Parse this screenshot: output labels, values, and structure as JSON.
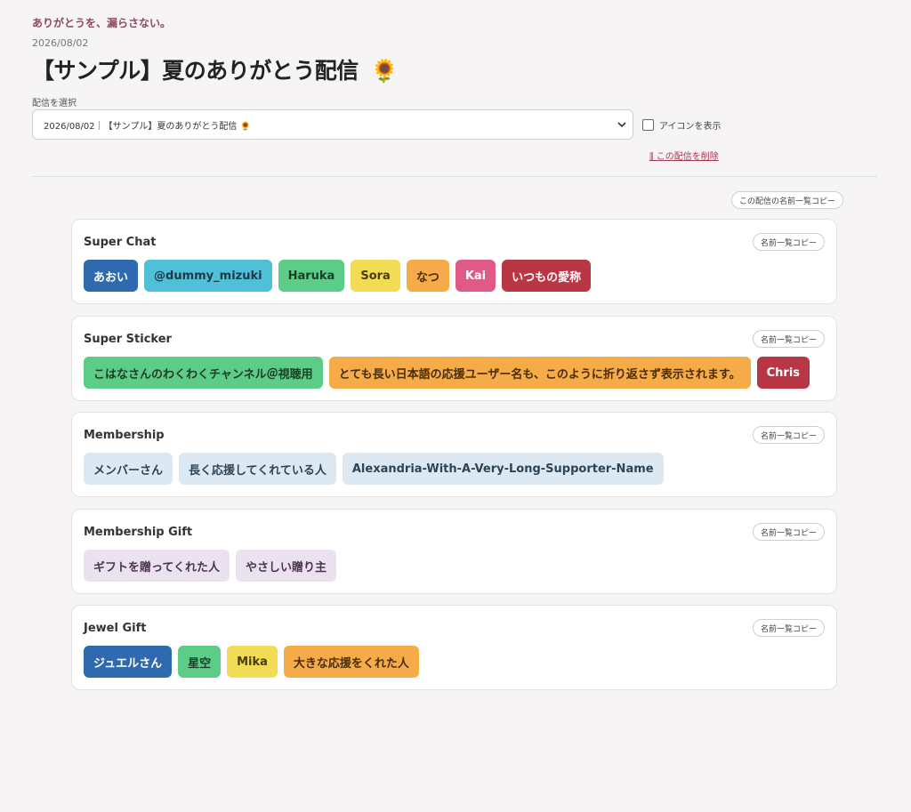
{
  "tagline": "ありがとうを、漏らさない。",
  "date": "2026/08/02",
  "title": "【サンプル】夏のありがとう配信",
  "title_emoji": "🌻",
  "select": {
    "label": "配信を選択",
    "value": "2026/08/02｜【サンプル】夏のありがとう配信 🌻"
  },
  "show_icons_label": "アイコンを表示",
  "delete_label": "この配信を削除",
  "copy_all_label": "この配信の名前一覧コピー",
  "colors": {
    "blue": "#2e6aad",
    "cyan": "#4fc0d8",
    "green": "#5ccc86",
    "yellow": "#f2dc55",
    "orange": "#f5ab48",
    "pink": "#df5a88",
    "red": "#b93744",
    "lightblue": "#dde9f2",
    "lavender": "#ebe2ef"
  },
  "sections": [
    {
      "title": "Super Chat",
      "copy_label": "名前一覧コピー",
      "names": [
        {
          "name": "あおい",
          "color": "blue"
        },
        {
          "name": "@dummy_mizuki",
          "color": "cyan"
        },
        {
          "name": "Haruka",
          "color": "green"
        },
        {
          "name": "Sora",
          "color": "yellow"
        },
        {
          "name": "なつ",
          "color": "orange"
        },
        {
          "name": "Kai",
          "color": "pink"
        },
        {
          "name": "いつもの愛称",
          "color": "red"
        }
      ]
    },
    {
      "title": "Super Sticker",
      "copy_label": "名前一覧コピー",
      "names": [
        {
          "name": "こはなさんのわくわくチャンネル＠視聴用",
          "color": "green"
        },
        {
          "name": "とても長い日本語の応援ユーザー名も、このように折り返さず表示されます。",
          "color": "orange"
        },
        {
          "name": "Chris",
          "color": "red"
        }
      ]
    },
    {
      "title": "Membership",
      "copy_label": "名前一覧コピー",
      "names": [
        {
          "name": "メンバーさん",
          "color": "lightblue"
        },
        {
          "name": "長く応援してくれている人",
          "color": "lightblue"
        },
        {
          "name": "Alexandria-With-A-Very-Long-Supporter-Name",
          "color": "lightblue"
        }
      ]
    },
    {
      "title": "Membership Gift",
      "copy_label": "名前一覧コピー",
      "names": [
        {
          "name": "ギフトを贈ってくれた人",
          "color": "lavender"
        },
        {
          "name": "やさしい贈り主",
          "color": "lavender"
        }
      ]
    },
    {
      "title": "Jewel Gift",
      "copy_label": "名前一覧コピー",
      "names": [
        {
          "name": "ジュエルさん",
          "color": "blue"
        },
        {
          "name": "星空",
          "color": "green"
        },
        {
          "name": "Mika",
          "color": "yellow"
        },
        {
          "name": "大きな応援をくれた人",
          "color": "orange"
        }
      ]
    }
  ]
}
